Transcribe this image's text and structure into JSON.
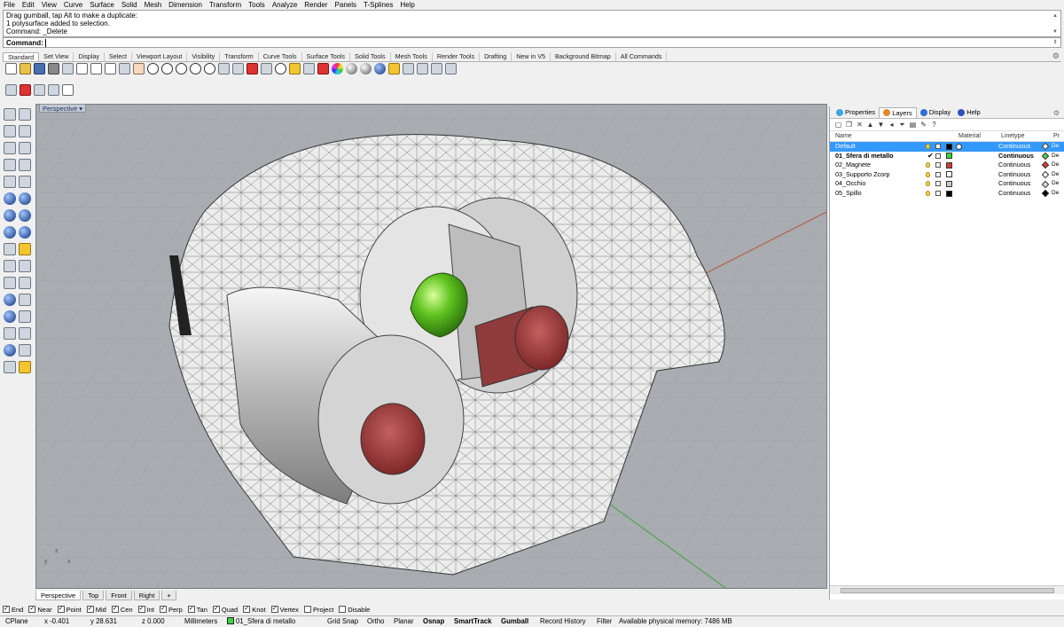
{
  "menu": [
    "File",
    "Edit",
    "View",
    "Curve",
    "Surface",
    "Solid",
    "Mesh",
    "Dimension",
    "Transform",
    "Tools",
    "Analyze",
    "Render",
    "Panels",
    "T-Splines",
    "Help"
  ],
  "command_history": [
    "Drag gumball, tap Alt to make a duplicate:",
    "1 polysurface added to selection.",
    "Command: _Delete"
  ],
  "command_prompt": "Command:",
  "toolbar_tabs": [
    "Standard",
    "Set View",
    "Display",
    "Select",
    "Viewport Layout",
    "Visibility",
    "Transform",
    "Curve Tools",
    "Surface Tools",
    "Solid Tools",
    "Mesh Tools",
    "Render Tools",
    "Drafting",
    "New in V5",
    "Background Bitmap",
    "All Commands"
  ],
  "active_toolbar_tab": "Standard",
  "standard_icons": [
    "new-document",
    "open-folder",
    "save-disk",
    "print",
    "import",
    "cut",
    "copy",
    "paste",
    "undo",
    "pan-hand",
    "zoom",
    "zoom-window",
    "zoom-extents",
    "zoom-selected",
    "zoom-all",
    "grid",
    "mesh-tools",
    "car-render",
    "wire",
    "lens",
    "light-bulb",
    "lock",
    "object-color",
    "color-wheel",
    "render-sphere",
    "shaded-sphere",
    "blue-sphere",
    "options",
    "gear",
    "snap",
    "analyze",
    "help"
  ],
  "secondary_icons": [
    "rotate-3d",
    "block",
    "layer-state",
    "print-preview",
    "flamingo"
  ],
  "viewport": {
    "label": "Perspective",
    "tabs": [
      "Perspective",
      "Top",
      "Front",
      "Right"
    ],
    "active_tab": "Perspective",
    "axis_labels": [
      "z",
      "x",
      "y"
    ]
  },
  "panel": {
    "tabs": [
      "Properties",
      "Layers",
      "Display",
      "Help"
    ],
    "active_tab": "Layers",
    "columns": {
      "name": "Name",
      "material": "Material",
      "linetype": "Linetype",
      "print": "Pr"
    },
    "layers": [
      {
        "name": "Default",
        "current": false,
        "color": "#000000",
        "linetype": "Continuous",
        "print_color": "#ffffff",
        "selected": true
      },
      {
        "name": "01_Sfera di metallo",
        "current": true,
        "color": "#38d438",
        "linetype": "Continuous",
        "print_color": "#4ed24e",
        "selected": false
      },
      {
        "name": "02_Magnete",
        "current": false,
        "color": "#d23c3c",
        "linetype": "Continuous",
        "print_color": "#d23c3c",
        "selected": false
      },
      {
        "name": "03_Supporto Zcorp",
        "current": false,
        "color": "#ffffff",
        "linetype": "Continuous",
        "print_color": "#ffffff",
        "selected": false
      },
      {
        "name": "04_Occhio",
        "current": false,
        "color": "#c8c8c8",
        "linetype": "Continuous",
        "print_color": "#dddddd",
        "selected": false
      },
      {
        "name": "05_Spillo",
        "current": false,
        "color": "#000000",
        "linetype": "Continuous",
        "print_color": "#000000",
        "selected": false
      }
    ],
    "print_label": "De"
  },
  "osnaps": [
    {
      "label": "End",
      "checked": true
    },
    {
      "label": "Near",
      "checked": true
    },
    {
      "label": "Point",
      "checked": true
    },
    {
      "label": "Mid",
      "checked": true
    },
    {
      "label": "Cen",
      "checked": true
    },
    {
      "label": "Int",
      "checked": true
    },
    {
      "label": "Perp",
      "checked": true
    },
    {
      "label": "Tan",
      "checked": true
    },
    {
      "label": "Quad",
      "checked": true
    },
    {
      "label": "Knot",
      "checked": true
    },
    {
      "label": "Vertex",
      "checked": true
    },
    {
      "label": "Project",
      "checked": false
    },
    {
      "label": "Disable",
      "checked": false
    }
  ],
  "status": {
    "cplane": "CPlane",
    "x": "x -0.401",
    "y": "y 28.631",
    "z": "z 0.000",
    "units": "Millimeters",
    "layer": "01_Sfera di metallo",
    "grid_snap": "Grid Snap",
    "ortho": "Ortho",
    "planar": "Planar",
    "osnap": "Osnap",
    "smarttrack": "SmartTrack",
    "gumball": "Gumball",
    "record_history": "Record History",
    "filter": "Filter",
    "memory": "Available physical memory: 7486 MB"
  },
  "colors": {
    "viewport_bg": "#a9acb1",
    "selection": "#3399ff",
    "layer_green": "#38d438"
  }
}
